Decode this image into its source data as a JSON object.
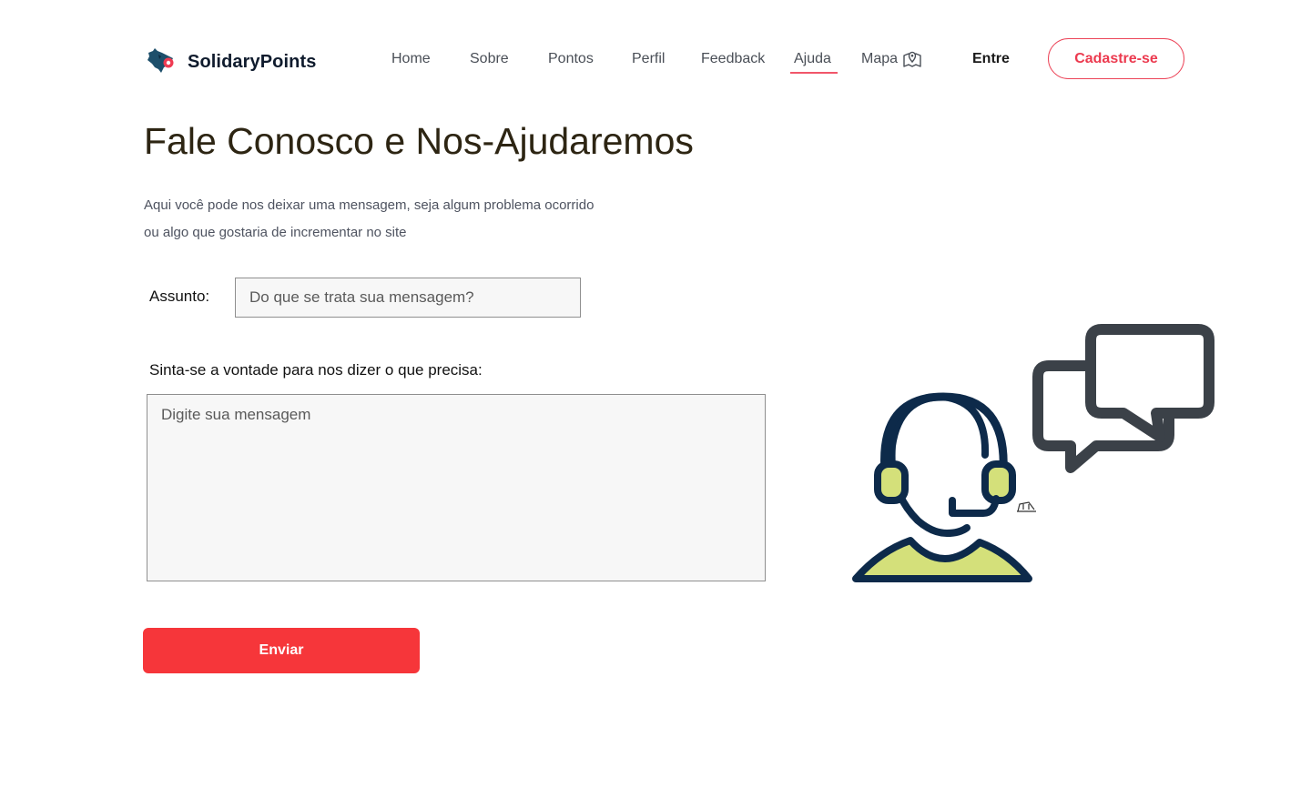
{
  "header": {
    "brand_prefix": "Solidary",
    "brand_suffix": "Points",
    "nav": [
      {
        "label": "Home"
      },
      {
        "label": "Sobre"
      },
      {
        "label": "Pontos"
      },
      {
        "label": "Perfil"
      },
      {
        "label": "Feedback"
      },
      {
        "label": "Ajuda",
        "active": true
      },
      {
        "label": "Mapa",
        "icon": "map-pin-icon"
      }
    ],
    "login_label": "Entre",
    "signup_label": "Cadastre-se"
  },
  "main": {
    "title": "Fale Conosco e Nos-Ajudaremos",
    "intro_line1": "Aqui você pode nos deixar uma mensagem, seja algum problema ocorrido",
    "intro_line2": "ou algo que gostaria de incrementar no site",
    "subject_label": "Assunto:",
    "subject_placeholder": "Do que se trata sua mensagem?",
    "message_label": "Sinta-se a vontade para nos dizer o que precisa:",
    "message_placeholder": "Digite sua mensagem",
    "submit_label": "Enviar"
  },
  "illustration": {
    "icon": "customer-support-icon",
    "bubble_icon": "chat-bubbles-icon"
  },
  "colors": {
    "accent": "#f6363a",
    "signup_border": "#ec4458",
    "active_underline": "#f1566a",
    "headset_navy": "#0d2a4a",
    "headset_green": "#d4e07a",
    "bubble_gray": "#3b4148"
  }
}
